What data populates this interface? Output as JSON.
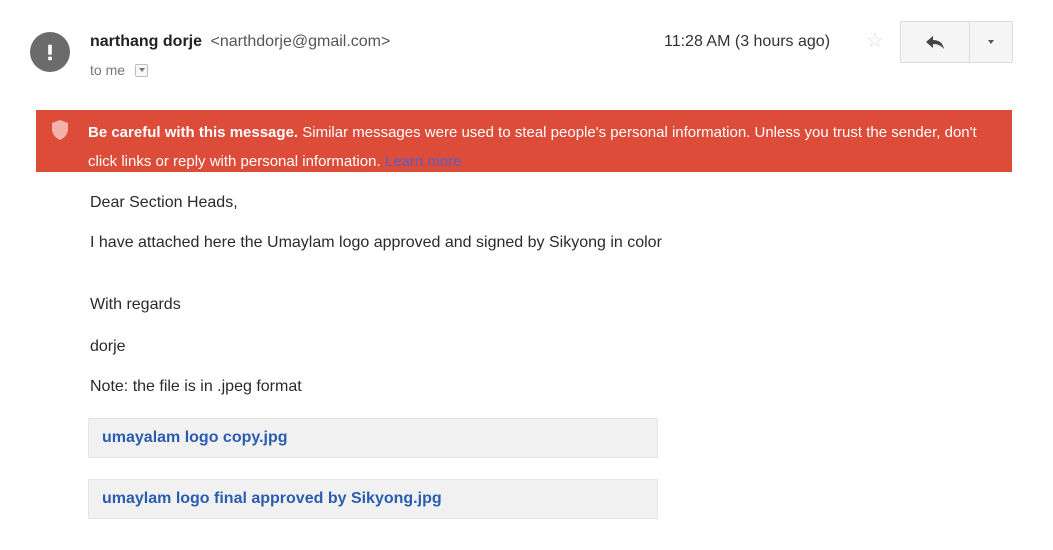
{
  "header": {
    "sender_name": "narthang dorje",
    "sender_email": "<narthdorje@gmail.com>",
    "to_label": "to me",
    "timestamp": "11:28 AM (3 hours ago)",
    "avatar_icon": "warning-exclamation-icon",
    "star_icon": "star-outline-icon",
    "reply_icon": "reply-arrow-icon",
    "more_icon": "chevron-down-icon"
  },
  "warning": {
    "bold_text": "Be careful with this message.",
    "text": " Similar messages were used to steal people's personal information. Unless you trust the sender, don't click links or reply with personal information. ",
    "link_text": "Learn more",
    "icon": "shield-icon",
    "background_color": "#dd4b39"
  },
  "body": {
    "greeting": "Dear Section Heads,",
    "line1": "I have attached here the Umaylam logo approved and signed by Sikyong in color",
    "regards": "With regards",
    "signature": "dorje",
    "note": "Note: the file is in .jpeg format"
  },
  "attachments": [
    {
      "name": "umayalam logo copy.jpg"
    },
    {
      "name": "umaylam logo final approved by Sikyong.jpg"
    }
  ],
  "colors": {
    "link": "#2a5db0",
    "warning_link": "#5a5fc4"
  }
}
